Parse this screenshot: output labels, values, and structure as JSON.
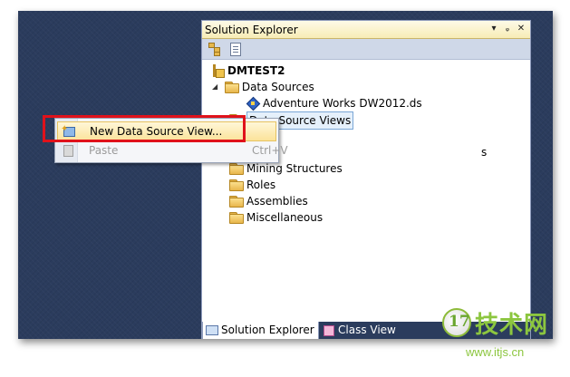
{
  "solution_explorer": {
    "title": "Solution Explorer",
    "title_icons": [
      "dropdown-arrow-icon",
      "pin-icon",
      "close-icon"
    ],
    "toolbar_icons": [
      "properties-icon",
      "show-all-files-icon"
    ],
    "tree": {
      "project": "DMTEST2",
      "data_sources": {
        "label": "Data Sources",
        "items": [
          "Adventure Works DW2012.ds"
        ]
      },
      "data_source_views": "Data Source Views",
      "folders_partial": [
        "s"
      ],
      "folders": [
        "Mining Structures",
        "Roles",
        "Assemblies",
        "Miscellaneous"
      ]
    }
  },
  "bottom_tabs": [
    "Solution Explorer",
    "Class View"
  ],
  "context_menu": {
    "items": [
      {
        "label": "New Data Source View...",
        "shortcut": "",
        "enabled": true
      },
      {
        "label": "Paste",
        "shortcut": "Ctrl+V",
        "enabled": false
      }
    ]
  },
  "watermark": {
    "logo_text": "17",
    "title": "技术网",
    "url": "www.itjs.cn"
  },
  "colors": {
    "ide_background": "#2b3c5d",
    "highlight_box": "#e0121b",
    "watermark_green": "#8cc63f"
  }
}
